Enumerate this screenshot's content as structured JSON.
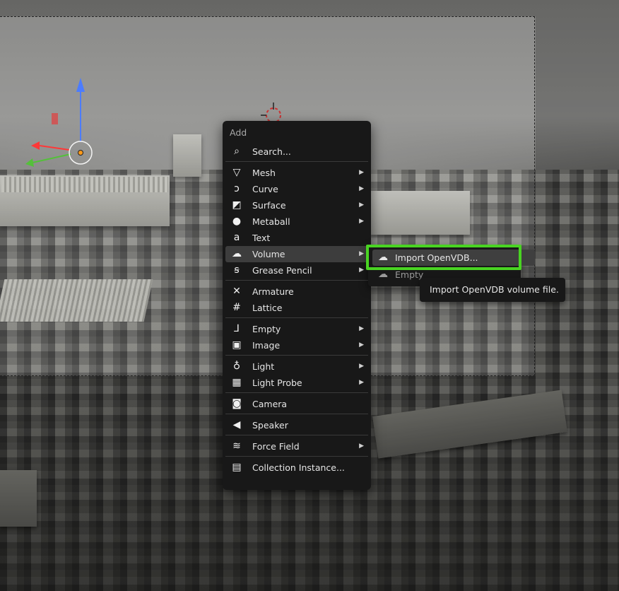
{
  "menu": {
    "title": "Add",
    "search": "Search...",
    "group1": [
      {
        "label": "Mesh",
        "icon": "mesh-icon",
        "glyph": "▽",
        "submenu": true
      },
      {
        "label": "Curve",
        "icon": "curve-icon",
        "glyph": "ↄ",
        "submenu": true
      },
      {
        "label": "Surface",
        "icon": "surface-icon",
        "glyph": "◩",
        "submenu": true
      },
      {
        "label": "Metaball",
        "icon": "metaball-icon",
        "glyph": "●",
        "submenu": true
      },
      {
        "label": "Text",
        "icon": "text-icon",
        "glyph": "a",
        "submenu": false
      },
      {
        "label": "Volume",
        "icon": "volume-icon",
        "glyph": "☁",
        "submenu": true
      },
      {
        "label": "Grease Pencil",
        "icon": "grease-pencil-icon",
        "glyph": "ꞩ",
        "submenu": true
      }
    ],
    "group2": [
      {
        "label": "Armature",
        "icon": "armature-icon",
        "glyph": "✕",
        "submenu": false
      },
      {
        "label": "Lattice",
        "icon": "lattice-icon",
        "glyph": "#",
        "submenu": false
      }
    ],
    "group3": [
      {
        "label": "Empty",
        "icon": "empty-icon",
        "glyph": "⅃",
        "submenu": true
      },
      {
        "label": "Image",
        "icon": "image-icon",
        "glyph": "▣",
        "submenu": true
      }
    ],
    "group4": [
      {
        "label": "Light",
        "icon": "light-icon",
        "glyph": "♁",
        "submenu": true
      },
      {
        "label": "Light Probe",
        "icon": "light-probe-icon",
        "glyph": "▦",
        "submenu": true
      }
    ],
    "group5": [
      {
        "label": "Camera",
        "icon": "camera-icon",
        "glyph": "◙",
        "submenu": false
      }
    ],
    "group6": [
      {
        "label": "Speaker",
        "icon": "speaker-icon",
        "glyph": "◀",
        "submenu": false
      }
    ],
    "group7": [
      {
        "label": "Force Field",
        "icon": "force-field-icon",
        "glyph": "≋",
        "submenu": true
      }
    ],
    "group8": [
      {
        "label": "Collection Instance...",
        "icon": "collection-instance-icon",
        "glyph": "▤",
        "submenu": false
      }
    ],
    "active": "Volume"
  },
  "submenu": {
    "items": [
      {
        "label": "Import OpenVDB...",
        "icon": "volume-icon"
      },
      {
        "label": "Empty",
        "icon": "volume-icon"
      }
    ]
  },
  "tooltip": "Import OpenVDB volume file.",
  "colors": {
    "highlight": "#49d422",
    "menu_bg": "#181818"
  }
}
